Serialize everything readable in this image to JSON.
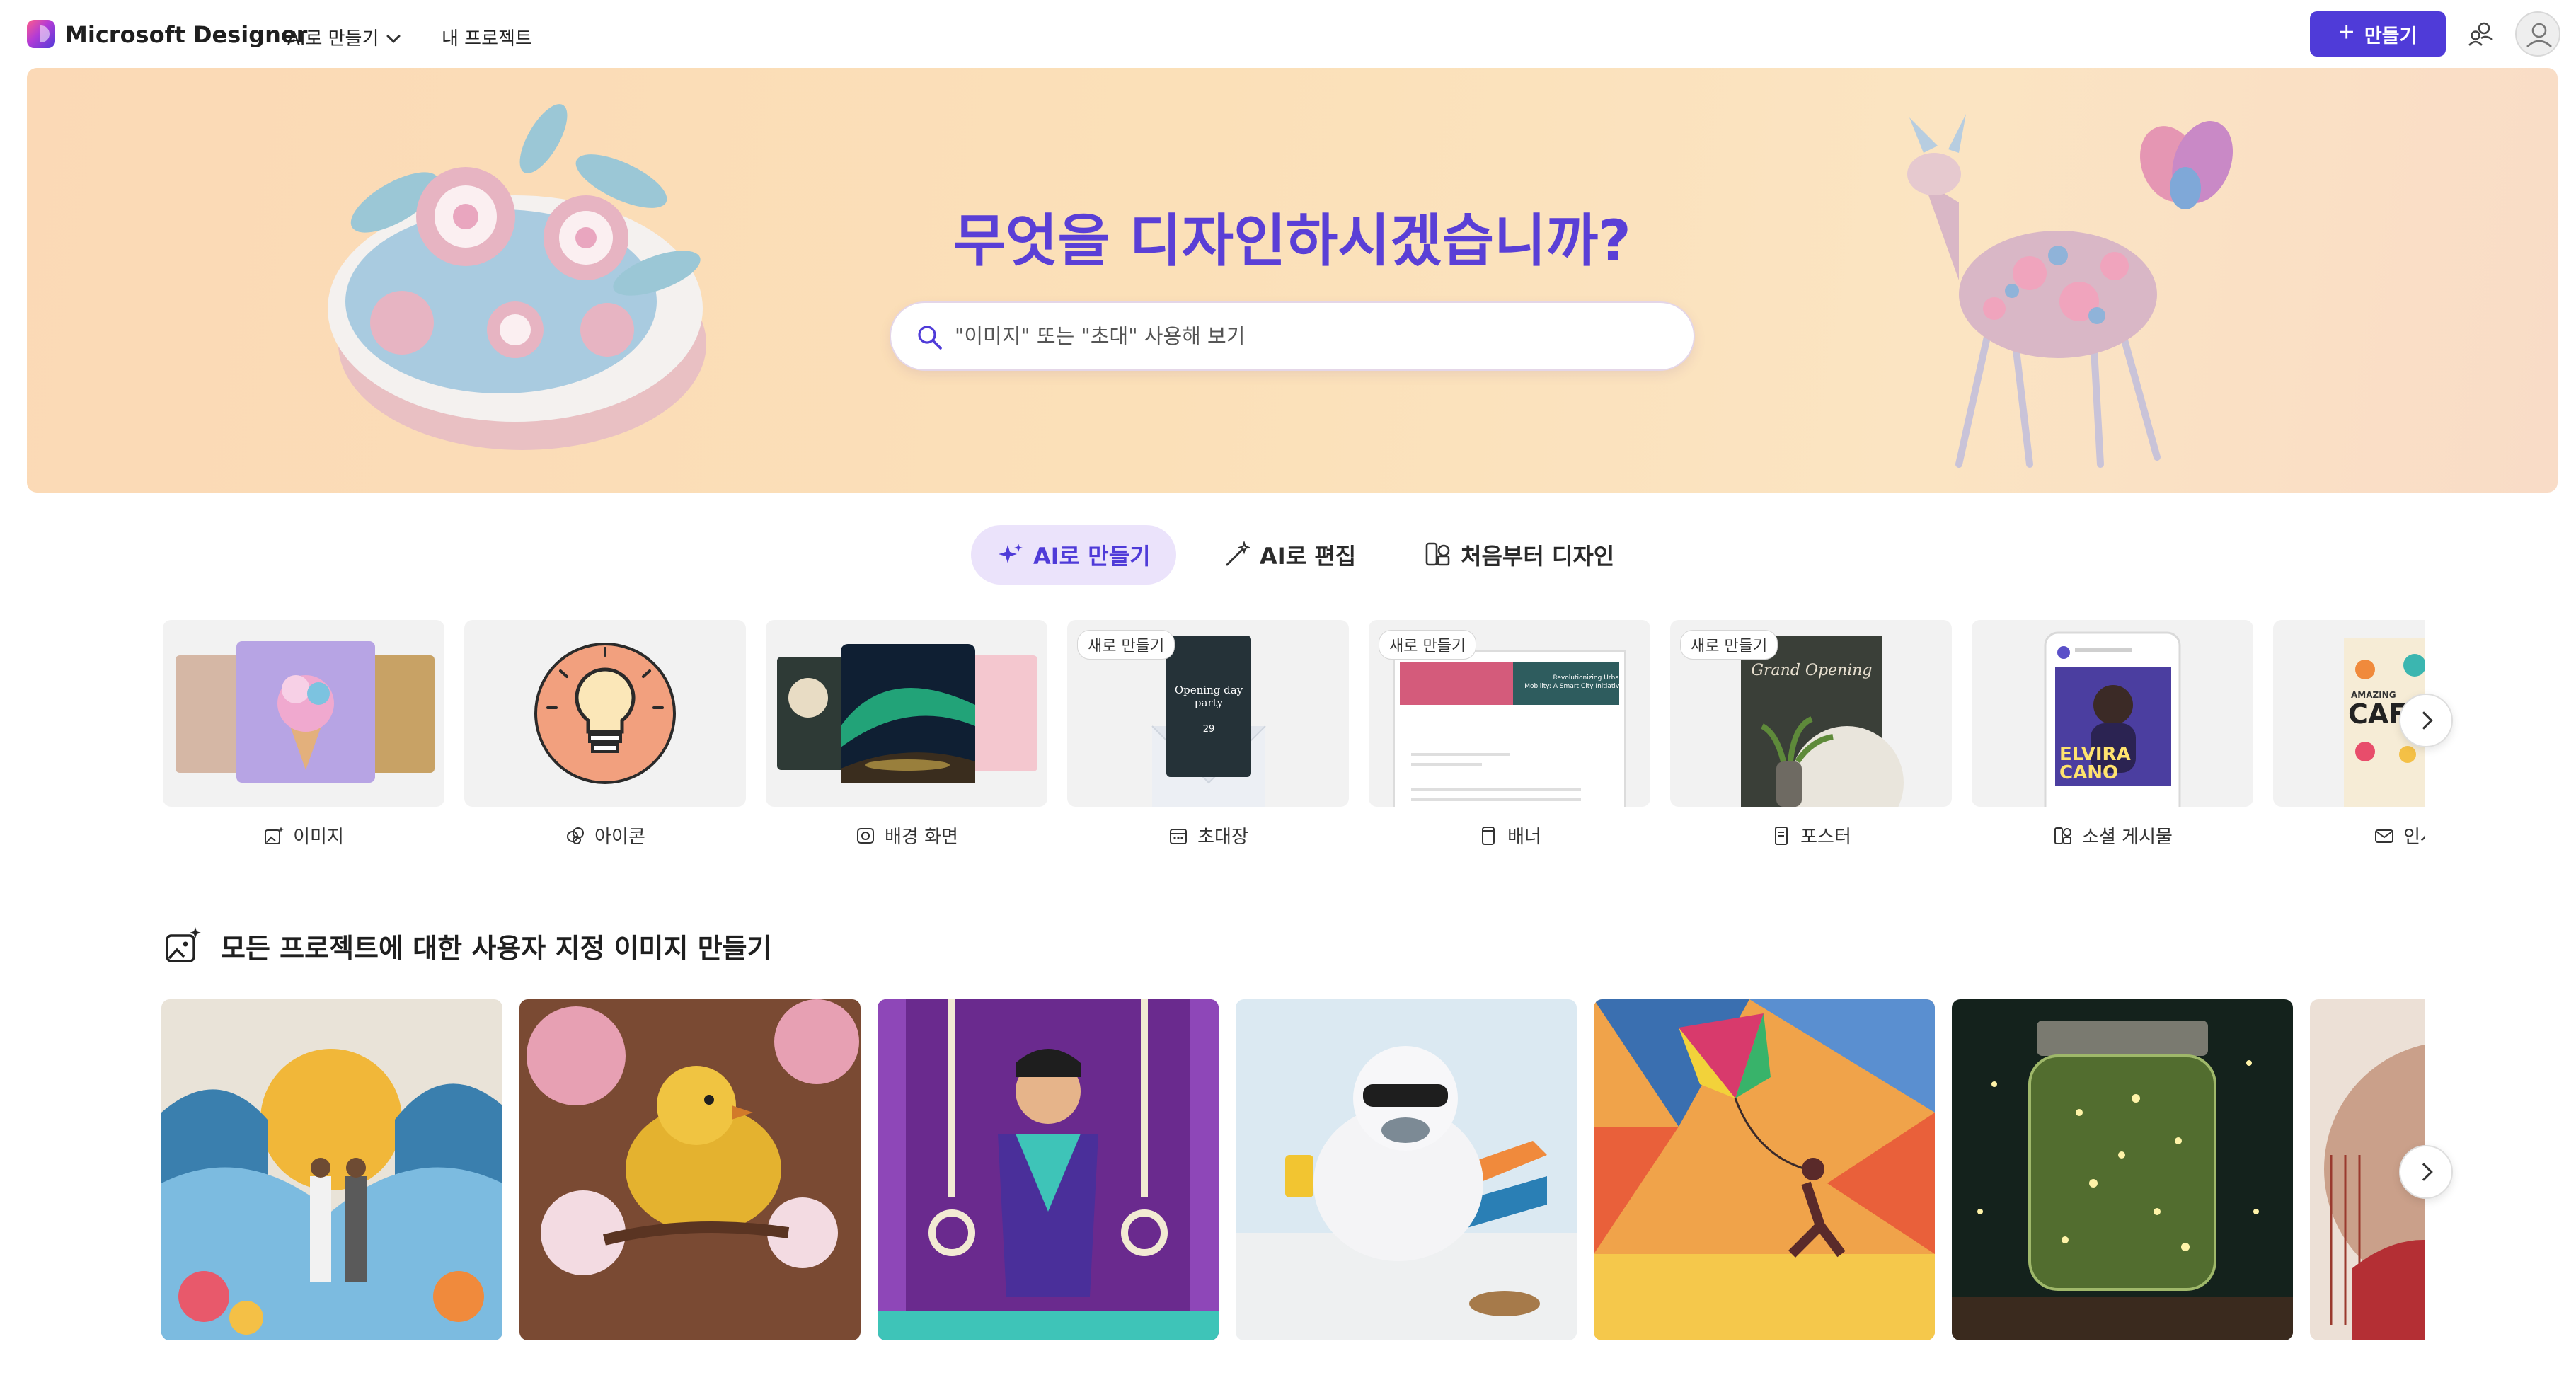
{
  "header": {
    "brand": "Microsoft Designer",
    "nav_ai": "AI로 만들기",
    "nav_projects": "내 프로젝트",
    "create_label": "만들기"
  },
  "hero": {
    "title": "무엇을 디자인하시겠습니까?",
    "search_placeholder": "\"이미지\" 또는 \"초대\" 사용해 보기"
  },
  "tabs": [
    {
      "label": "AI로 만들기",
      "icon": "sparkle-icon",
      "active": true
    },
    {
      "label": "AI로 편집",
      "icon": "magic-wand-icon",
      "active": false
    },
    {
      "label": "처음부터 디자인",
      "icon": "design-icon",
      "active": false
    }
  ],
  "templates": [
    {
      "label": "이미지",
      "icon": "image-sparkle-icon",
      "badge": ""
    },
    {
      "label": "아이콘",
      "icon": "icon-shapes-icon",
      "badge": ""
    },
    {
      "label": "배경 화면",
      "icon": "wallpaper-icon",
      "badge": ""
    },
    {
      "label": "초대장",
      "icon": "calendar-icon",
      "badge": "새로 만들기",
      "thumb_text": [
        "Opening day",
        "party",
        "29"
      ]
    },
    {
      "label": "배너",
      "icon": "banner-icon",
      "badge": "새로 만들기",
      "thumb_text": [
        "Revolutionizing Urban",
        "Mobility: A Smart City Initiative"
      ]
    },
    {
      "label": "포스터",
      "icon": "poster-icon",
      "badge": "새로 만들기",
      "thumb_text": [
        "Grand Opening"
      ]
    },
    {
      "label": "소셜 게시물",
      "icon": "social-post-icon",
      "badge": "",
      "thumb_text": [
        "ELVIRA",
        "CANO"
      ]
    },
    {
      "label": "인사말",
      "icon": "mail-icon",
      "badge": "",
      "thumb_text": [
        "AMAZING",
        "CAF"
      ]
    }
  ],
  "section": {
    "title": "모든 프로젝트에 대한 사용자 지정 이미지 만들기"
  },
  "gallery": [
    {
      "name": "hawaiian-wedding-image"
    },
    {
      "name": "yellow-bird-image"
    },
    {
      "name": "gymnast-image"
    },
    {
      "name": "yeti-beach-image"
    },
    {
      "name": "kite-runner-image"
    },
    {
      "name": "firefly-jar-image"
    },
    {
      "name": "partial-fan-image"
    }
  ],
  "colors": {
    "accent": "#4f3bd8",
    "hero_title": "#5a3fd6",
    "tab_active_bg": "#ebe3fb",
    "hero_bg_start": "#fbd9b6",
    "hero_bg_end": "#f9dcc7"
  }
}
